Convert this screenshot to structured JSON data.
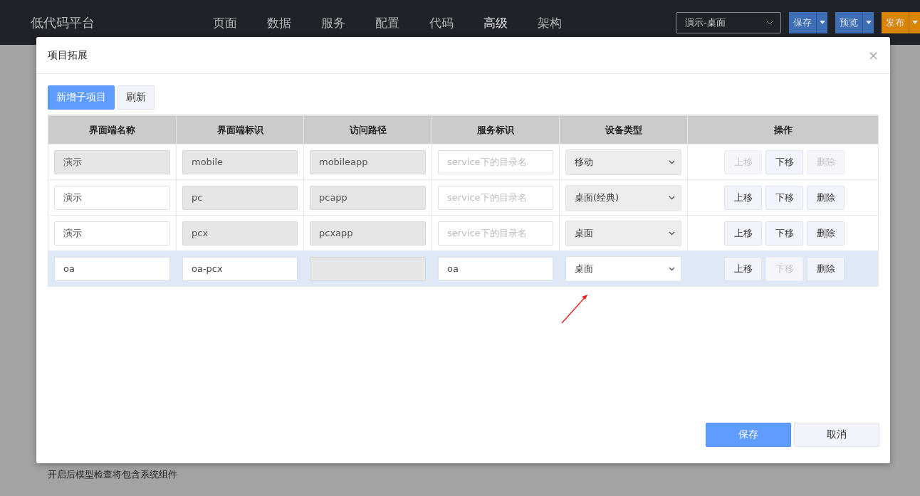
{
  "topbar": {
    "logo": "低代码平台",
    "nav": [
      {
        "label": "页面",
        "selected": false
      },
      {
        "label": "数据",
        "selected": false
      },
      {
        "label": "服务",
        "selected": false
      },
      {
        "label": "配置",
        "selected": false
      },
      {
        "label": "代码",
        "selected": false
      },
      {
        "label": "高级",
        "selected": true
      },
      {
        "label": "架构",
        "selected": false
      }
    ],
    "env_select": "演示-桌面",
    "buttons": [
      {
        "label": "保存",
        "color": "#3d6db5"
      },
      {
        "label": "预览",
        "color": "#3d6db5"
      },
      {
        "label": "发布",
        "color": "#d98500"
      }
    ]
  },
  "background_text": "开启后模型检查将包含系统组件",
  "dialog": {
    "title": "项目拓展",
    "close": "×",
    "toolbar": [
      {
        "label": "新增子项目",
        "kind": "primary"
      },
      {
        "label": "刷新",
        "kind": "default"
      }
    ],
    "columns": [
      "界面端名称",
      "界面端标识",
      "访问路径",
      "服务标识",
      "设备类型",
      "操作"
    ],
    "rows": [
      {
        "selected": false,
        "name": {
          "value": "演示",
          "disabled": true
        },
        "ident": {
          "value": "mobile",
          "disabled": true
        },
        "path": {
          "value": "mobileapp",
          "disabled": true
        },
        "service": {
          "placeholder": "service下的目录名",
          "disabled": false
        },
        "device": {
          "value": "移动",
          "disabled": true
        },
        "actions": [
          {
            "label": "上移",
            "disabled": true
          },
          {
            "label": "下移",
            "disabled": false
          },
          {
            "label": "删除",
            "disabled": true
          }
        ]
      },
      {
        "selected": false,
        "name": {
          "value": "演示",
          "disabled": false
        },
        "ident": {
          "value": "pc",
          "disabled": true
        },
        "path": {
          "value": "pcapp",
          "disabled": true
        },
        "service": {
          "placeholder": "service下的目录名",
          "disabled": false
        },
        "device": {
          "value": "桌面(经典)",
          "disabled": true
        },
        "actions": [
          {
            "label": "上移",
            "disabled": false
          },
          {
            "label": "下移",
            "disabled": false
          },
          {
            "label": "删除",
            "disabled": false
          }
        ]
      },
      {
        "selected": false,
        "name": {
          "value": "演示",
          "disabled": false
        },
        "ident": {
          "value": "pcx",
          "disabled": true
        },
        "path": {
          "value": "pcxapp",
          "disabled": true
        },
        "service": {
          "placeholder": "service下的目录名",
          "disabled": false
        },
        "device": {
          "value": "桌面",
          "disabled": true
        },
        "actions": [
          {
            "label": "上移",
            "disabled": false
          },
          {
            "label": "下移",
            "disabled": false
          },
          {
            "label": "删除",
            "disabled": false
          }
        ]
      },
      {
        "selected": true,
        "name": {
          "value": "oa",
          "disabled": false
        },
        "ident": {
          "value": "oa-pcx",
          "disabled": false
        },
        "path": {
          "disabled": true
        },
        "service": {
          "value": "oa",
          "disabled": false
        },
        "device": {
          "value": "桌面",
          "disabled": false
        },
        "actions": [
          {
            "label": "上移",
            "disabled": false
          },
          {
            "label": "下移",
            "disabled": true
          },
          {
            "label": "删除",
            "disabled": false
          }
        ]
      }
    ],
    "footer": [
      {
        "label": "保存",
        "kind": "primary"
      },
      {
        "label": "取消",
        "kind": "default"
      }
    ]
  }
}
